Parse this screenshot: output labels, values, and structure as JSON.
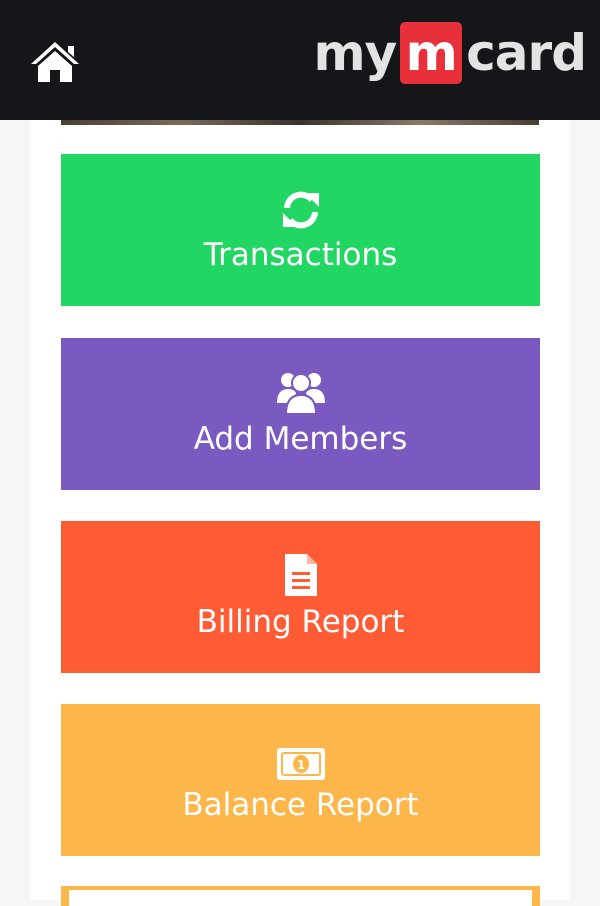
{
  "header": {
    "home_icon": "home-icon",
    "logo": {
      "part1": "my",
      "part2": "m",
      "part3": "card"
    }
  },
  "tiles": [
    {
      "label": "Transactions",
      "icon": "refresh-icon",
      "color": "#22d664"
    },
    {
      "label": "Add Members",
      "icon": "users-icon",
      "color": "#7a59c0"
    },
    {
      "label": "Billing Report",
      "icon": "document-icon",
      "color": "#ff5c36"
    },
    {
      "label": "Balance Report",
      "icon": "money-bill-icon",
      "color": "#fdb64a"
    }
  ],
  "colors": {
    "header_bg": "#141619",
    "logo_accent": "#e8303a",
    "page_bg": "#f5f6f8"
  }
}
